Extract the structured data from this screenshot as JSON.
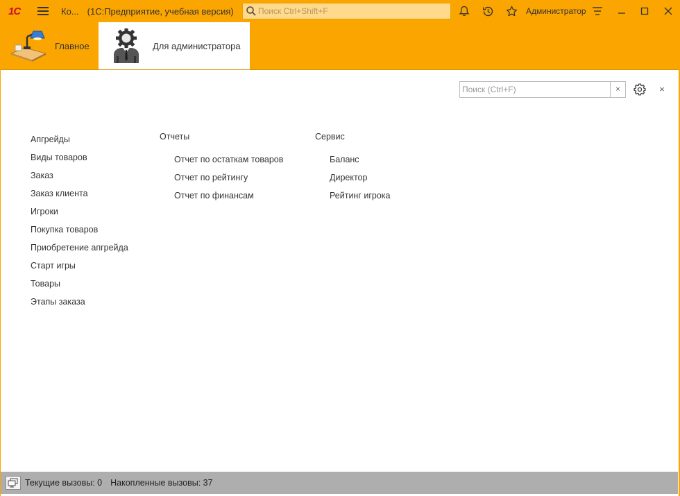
{
  "titlebar": {
    "logo": "1С",
    "short_title": "Ко...",
    "full_title": "(1С:Предприятие, учебная версия)",
    "search_placeholder": "Поиск Ctrl+Shift+F",
    "user": "Администратор"
  },
  "sections": [
    {
      "label": "Главное",
      "icon": "desk-lamp-icon",
      "active": false
    },
    {
      "label": "Для администратора",
      "icon": "admin-gear-person-icon",
      "active": true
    }
  ],
  "content": {
    "search_placeholder": "Поиск (Ctrl+F)",
    "clear_label": "×",
    "close_label": "×",
    "main_links": [
      "Апгрейды",
      "Виды товаров",
      "Заказ",
      "Заказ клиента",
      "Игроки",
      "Покупка товаров",
      "Приобретение апгрейда",
      "Старт игры",
      "Товары",
      "Этапы заказа"
    ],
    "reports": {
      "title": "Отчеты",
      "links": [
        "Отчет по остаткам товаров",
        "Отчет по рейтингу",
        "Отчет по финансам"
      ]
    },
    "service": {
      "title": "Сервис",
      "links": [
        "Баланс",
        "Директор",
        "Рейтинг игрока"
      ]
    }
  },
  "statusbar": {
    "current_calls": "Текущие вызовы: 0",
    "accumulated_calls": "Накопленные вызовы: 37"
  },
  "colors": {
    "accent": "#FBA500",
    "group_title": "#E0641E",
    "statusbar": "#AEAEAE"
  }
}
